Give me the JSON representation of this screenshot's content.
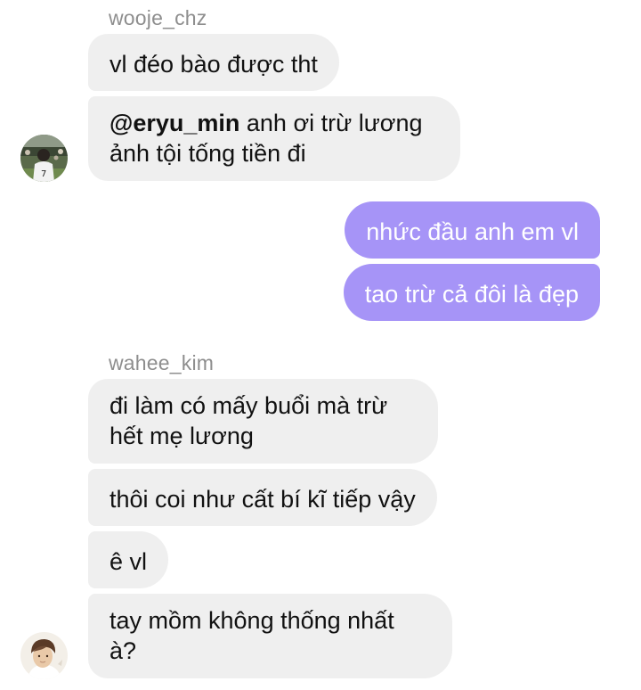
{
  "chat": {
    "group1": {
      "sender": "wooje_chz",
      "messages": [
        {
          "text": "vl đéo bào được tht"
        },
        {
          "mention": "@eryu_min",
          "text_line1": " anh ơi trừ lương",
          "text_line2": "ảnh tội tống tiền đi"
        }
      ]
    },
    "mine": {
      "messages": [
        {
          "text": "nhức đầu anh em vl"
        },
        {
          "text": "tao trừ cả đôi là đẹp"
        }
      ]
    },
    "group2": {
      "sender": "wahee_kim",
      "messages": [
        {
          "line1": "đi làm có mấy buổi mà trừ",
          "line2": "hết mẹ lương"
        },
        {
          "text": "thôi coi như cất bí kĩ tiếp vậy"
        },
        {
          "text": "ê vl"
        },
        {
          "line1": "tay mồm không thống nhất",
          "line2": "à?"
        }
      ]
    }
  },
  "colors": {
    "incoming_bubble": "#efefef",
    "outgoing_bubble": "#a694f7",
    "sender_name": "#8e8e8e"
  }
}
